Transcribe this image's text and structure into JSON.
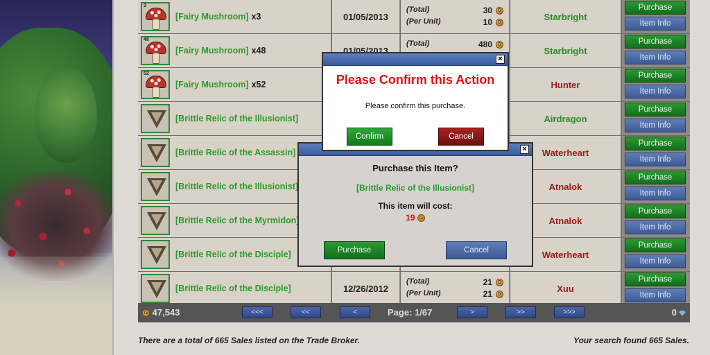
{
  "listings": [
    {
      "icon": "mushroom-icon",
      "qty": "3",
      "name": "[Fairy Mushroom]",
      "count": "x3",
      "date": "01/05/2013",
      "total_label": "(Total)",
      "total": "30",
      "unit_label": "(Per Unit)",
      "unit": "10",
      "seller": "Starbright",
      "seller_color": "#2a8a2a"
    },
    {
      "icon": "mushroom-icon",
      "qty": "48",
      "name": "[Fairy Mushroom]",
      "count": "x48",
      "date": "01/05/2013",
      "total_label": "(Total)",
      "total": "480",
      "unit_label": "",
      "unit": "",
      "seller": "Starbright",
      "seller_color": "#2a8a2a"
    },
    {
      "icon": "mushroom-icon",
      "qty": "52",
      "name": "[Fairy Mushroom]",
      "count": "x52",
      "date": "",
      "total_label": "",
      "total": "",
      "unit_label": "",
      "unit": "",
      "seller": "Hunter",
      "seller_color": "#9a1a1a"
    },
    {
      "icon": "relic-icon",
      "qty": "",
      "name": "[Brittle Relic of the Illusionist]",
      "count": "",
      "date": "",
      "total_label": "",
      "total": "",
      "unit_label": "",
      "unit": "",
      "seller": "Airdragon",
      "seller_color": "#2a8a2a"
    },
    {
      "icon": "relic-icon",
      "qty": "",
      "name": "[Brittle Relic of the Assassin]",
      "count": "",
      "date": "",
      "total_label": "",
      "total": "",
      "unit_label": "",
      "unit": "",
      "seller": "Waterheart",
      "seller_color": "#9a1a1a"
    },
    {
      "icon": "relic-icon",
      "qty": "",
      "name": "[Brittle Relic of the Illusionist]",
      "count": "",
      "date": "",
      "total_label": "",
      "total": "",
      "unit_label": "",
      "unit": "",
      "seller": "Atnalok",
      "seller_color": "#9a1a1a"
    },
    {
      "icon": "relic-icon",
      "qty": "",
      "name": "[Brittle Relic of the Myrmidon]",
      "count": "",
      "date": "",
      "total_label": "",
      "total": "",
      "unit_label": "",
      "unit": "",
      "seller": "Atnalok",
      "seller_color": "#9a1a1a"
    },
    {
      "icon": "relic-icon",
      "qty": "",
      "name": "[Brittle Relic of the Disciple]",
      "count": "",
      "date": "",
      "total_label": "",
      "total": "",
      "unit_label": "",
      "unit": "",
      "seller": "Waterheart",
      "seller_color": "#9a1a1a"
    },
    {
      "icon": "relic-icon",
      "qty": "",
      "name": "[Brittle Relic of the Disciple]",
      "count": "",
      "date": "12/26/2012",
      "total_label": "(Total)",
      "total": "21",
      "unit_label": "(Per Unit)",
      "unit": "21",
      "seller": "Xuu",
      "seller_color": "#9a1a1a"
    }
  ],
  "buttons": {
    "purchase": "Purchase",
    "item_info": "Item Info"
  },
  "coin_glyph": "G",
  "pager": {
    "gold": "47,543",
    "first": "<<<",
    "prev10": "<<",
    "prev": "<",
    "page": "Page: 1/67",
    "next": ">",
    "next10": ">>",
    "last": ">>>",
    "gems": "0"
  },
  "footer": {
    "left": "There are a total of 665 Sales listed on the Trade Broker.",
    "right": "Your search found 665 Sales."
  },
  "confirm_dialog": {
    "title": "Please Confirm this Action",
    "message": "Please confirm this purchase.",
    "confirm": "Confirm",
    "cancel": "Cancel",
    "close": "×"
  },
  "purchase_dialog": {
    "title": "Purchase this Item?",
    "item": "[Brittle Relic of the Illusionist]",
    "cost_label": "This item will cost:",
    "cost": "19",
    "purchase": "Purchase",
    "cancel": "Cancel",
    "close": "×"
  }
}
